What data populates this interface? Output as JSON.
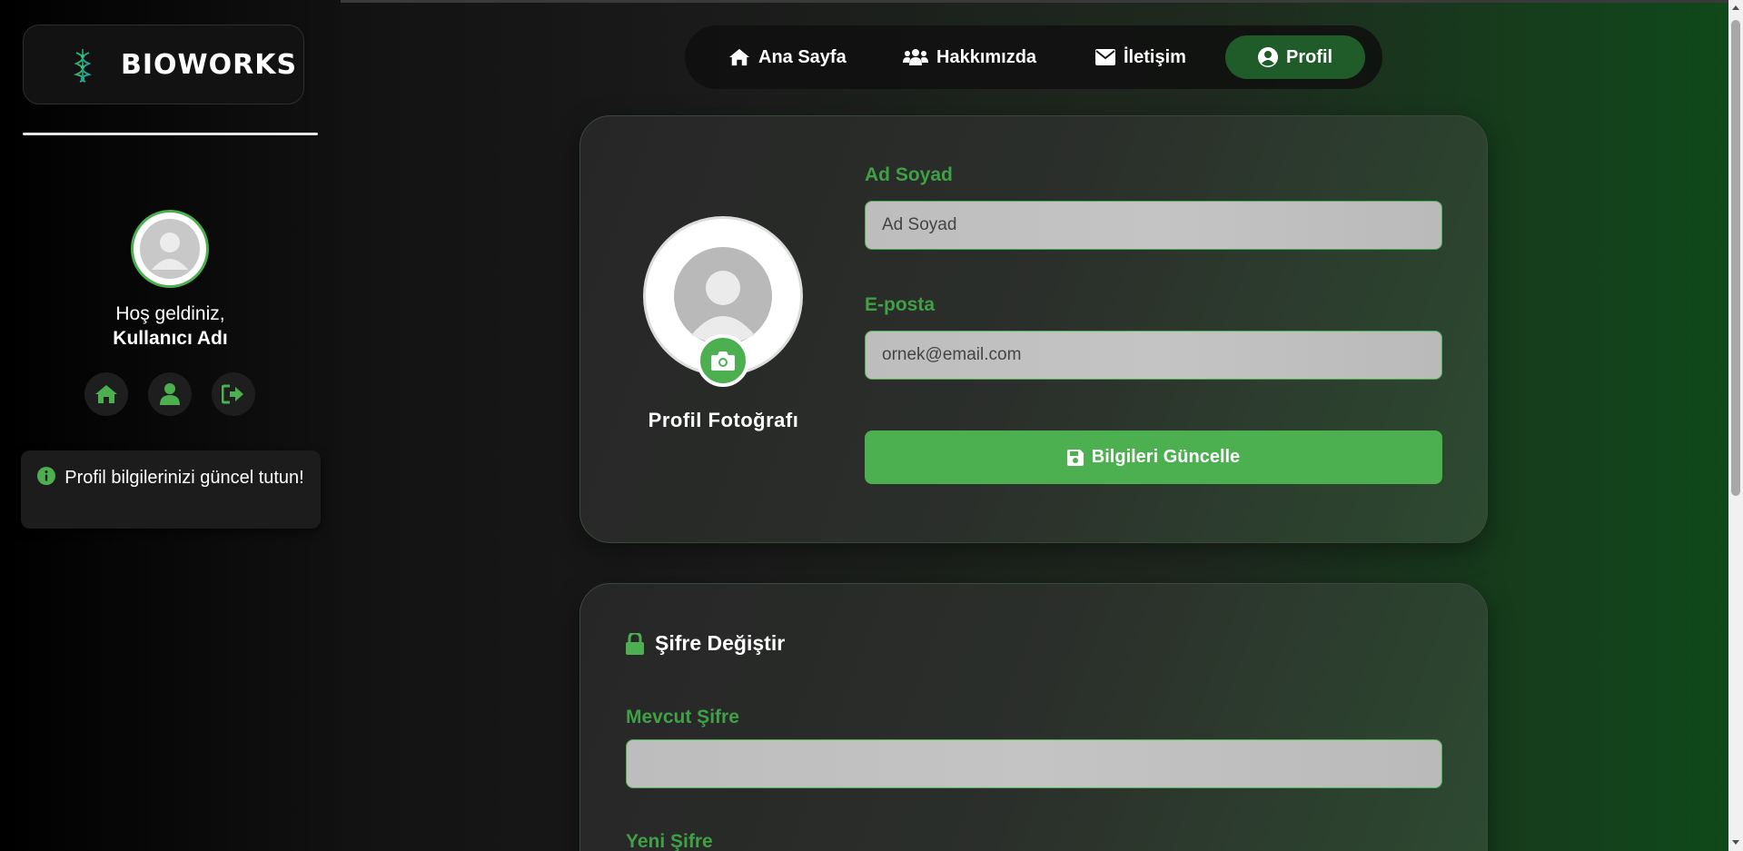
{
  "brand": {
    "name": "BIOWORKS",
    "logo_icon": "dna-leaf-icon"
  },
  "sidebar": {
    "welcome_line": "Hoş geldiniz,",
    "username": "Kullanıcı Adı",
    "quick_actions": [
      {
        "icon": "home-icon"
      },
      {
        "icon": "user-icon"
      },
      {
        "icon": "logout-icon"
      }
    ],
    "tip": "Profil bilgilerinizi güncel tutun!"
  },
  "nav": {
    "items": [
      {
        "label": "Ana Sayfa",
        "icon": "home-icon"
      },
      {
        "label": "Hakkımızda",
        "icon": "users-icon"
      },
      {
        "label": "İletişim",
        "icon": "envelope-icon"
      },
      {
        "label": "Profil",
        "icon": "user-circle-icon",
        "active": true
      }
    ]
  },
  "profile": {
    "photo_label": "Profil Fotoğrafı",
    "name_label": "Ad Soyad",
    "name_placeholder": "Ad Soyad",
    "email_label": "E-posta",
    "email_placeholder": "ornek@email.com",
    "update_button": "Bilgileri Güncelle"
  },
  "password": {
    "title": "Şifre Değiştir",
    "current_label": "Mevcut Şifre",
    "new_label": "Yeni Şifre"
  },
  "colors": {
    "accent": "#4caf50",
    "nav_active": "#1f5c2a",
    "label_green": "#3fa046"
  }
}
